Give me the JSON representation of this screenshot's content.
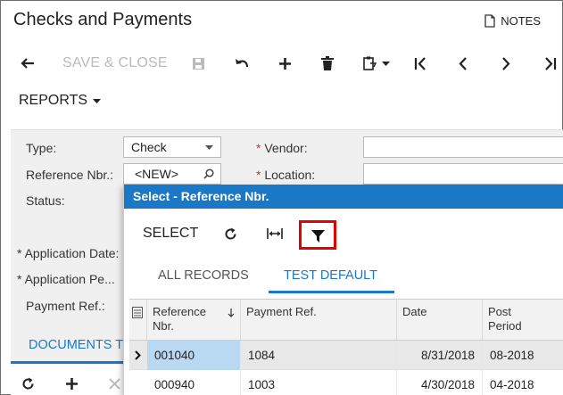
{
  "header": {
    "title": "Checks and Payments",
    "notes_label": "NOTES"
  },
  "toolbar": {
    "back_icon": "arrow-left-icon",
    "save_close_label": "SAVE & CLOSE",
    "icons": [
      "save-icon",
      "undo-icon",
      "plus-icon",
      "delete-icon",
      "clipboard-icon",
      "first-icon",
      "prev-icon",
      "next-icon",
      "last-icon"
    ]
  },
  "reports_label": "REPORTS",
  "form": {
    "type_label": "Type:",
    "type_value": "Check",
    "refnbr_label": "Reference Nbr.:",
    "refnbr_value": "<NEW>",
    "status_label": "Status:",
    "vendor_label": "Vendor:",
    "location_label": "Location:",
    "app_date_label": "Application Date:",
    "app_period_label": "Application Pe...",
    "payment_ref_label": "Payment Ref.:",
    "documents_tab_label": "DOCUMENTS T"
  },
  "dialog": {
    "title": "Select - Reference Nbr.",
    "select_label": "SELECT",
    "tabs": [
      {
        "label": "ALL RECORDS"
      },
      {
        "label": "TEST DEFAULT"
      }
    ],
    "columns": {
      "ref": "Reference\nNbr.",
      "payment_ref": "Payment Ref.",
      "date": "Date",
      "post_period": "Post\nPeriod"
    },
    "rows": [
      {
        "ref": "001040",
        "payment_ref": "1084",
        "date": "8/31/2018",
        "post_period": "08-2018"
      },
      {
        "ref": "000940",
        "payment_ref": "1003",
        "date": "4/30/2018",
        "post_period": "04-2018"
      }
    ]
  },
  "colors": {
    "accent": "#1a78c6",
    "highlight": "#e60000",
    "selected_cell": "#b9d8f2",
    "selected_row": "#e8e8e8"
  }
}
